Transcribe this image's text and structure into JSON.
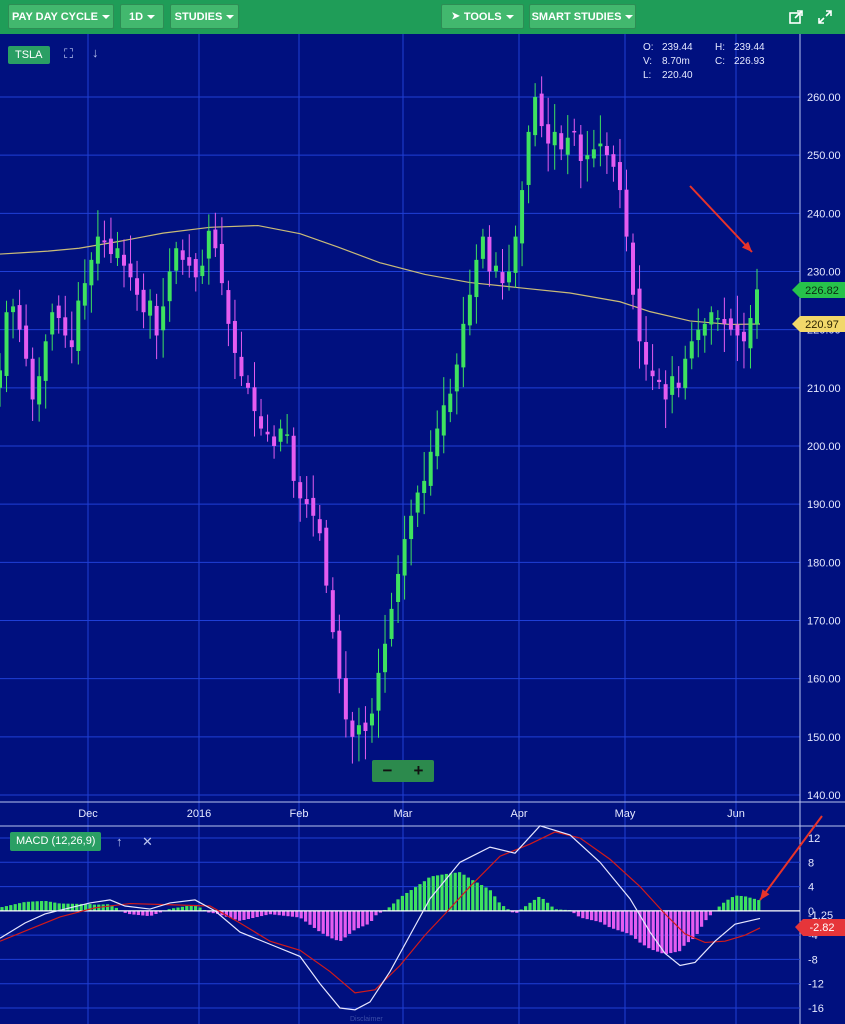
{
  "toolbar": {
    "cycle_label": "PAY DAY CYCLE",
    "interval_label": "1D",
    "studies_label": "STUDIES",
    "tools_label": "TOOLS",
    "smart_studies_label": "SMART STUDIES",
    "share_icon": "share-icon",
    "fullscreen_icon": "expand-icon"
  },
  "symbol": "TSLA",
  "ohlc": {
    "o_label": "O:",
    "o_value": "239.44",
    "h_label": "H:",
    "h_value": "239.44",
    "v_label": "V:",
    "v_value": "8.70m",
    "c_label": "C:",
    "c_value": "226.93",
    "l_label": "L:",
    "l_value": "220.40"
  },
  "price_badges": {
    "last": "226.82",
    "ma": "220.97"
  },
  "colors": {
    "background": "#00107f",
    "grid": "#1f3fd6",
    "up": "#3ee25f",
    "down": "#e45cf0",
    "ma_line": "#c9bb78",
    "macd_line": "#e6e6ff",
    "signal_line": "#d21a1a",
    "badge_last": "#27c34b",
    "badge_ma": "#f2d86a",
    "badge_macd": "#e6353a",
    "arrow": "#e8332a"
  },
  "zoom": {
    "minus": "−",
    "plus": "+"
  },
  "macd_panel": {
    "label": "MACD (12,26,9)",
    "value_a": "-1.25",
    "value_b": "-2.82"
  },
  "disclaimer": "Disclaimer",
  "chart_data": [
    {
      "type": "candlestick",
      "title": "TSLA",
      "ylim": [
        140,
        270
      ],
      "yticks": [
        "260.00",
        "250.00",
        "240.00",
        "230.00",
        "220.00",
        "210.00",
        "200.00",
        "190.00",
        "180.00",
        "170.00",
        "160.00",
        "150.00",
        "140.00"
      ],
      "xticks": [
        "Dec",
        "2016",
        "Feb",
        "Mar",
        "Apr",
        "May",
        "Jun"
      ],
      "key_points": {
        "x": [
          "Dec",
          "2016",
          "Feb",
          "Mar",
          "Apr",
          "May",
          "Jun"
        ],
        "close": [
          232,
          236,
          190,
          180,
          256,
          218,
          226.93
        ]
      },
      "closes": [
        213,
        223,
        224,
        220,
        215,
        208,
        212,
        218,
        223,
        222,
        219,
        217,
        225,
        228,
        232,
        236,
        235,
        233,
        234,
        231,
        229,
        226,
        223,
        225,
        219,
        224,
        230,
        234,
        232,
        231,
        229,
        231,
        237,
        234,
        228,
        221,
        216,
        212,
        210,
        206,
        203,
        202,
        200,
        203,
        202,
        194,
        191,
        190,
        188,
        185,
        176,
        168,
        160,
        153,
        150,
        152,
        151,
        154,
        161,
        166,
        172,
        178,
        184,
        188,
        192,
        194,
        199,
        203,
        207,
        209,
        214,
        221,
        226,
        232,
        236,
        230,
        231,
        228,
        230,
        236,
        244,
        254,
        260,
        255,
        252,
        254,
        251,
        253,
        254,
        249,
        250,
        251,
        252,
        250,
        248,
        244,
        236,
        226,
        218,
        214,
        212,
        211,
        208,
        212,
        210,
        215,
        218,
        220,
        221,
        223,
        222,
        221,
        220,
        219,
        218,
        222,
        226.93
      ],
      "ma_series": {
        "name": "",
        "points": [
          [
            0,
            233
          ],
          [
            20,
            233.2
          ],
          [
            48,
            233.5
          ],
          [
            79,
            234
          ],
          [
            120,
            235.2
          ],
          [
            163,
            236.6
          ],
          [
            210,
            237.6
          ],
          [
            258,
            237.9
          ],
          [
            300,
            236.5
          ],
          [
            338,
            234.2
          ],
          [
            380,
            231.5
          ],
          [
            425,
            229.5
          ],
          [
            470,
            228.1
          ],
          [
            520,
            227.2
          ],
          [
            570,
            226.3
          ],
          [
            620,
            224.8
          ],
          [
            650,
            223.1
          ],
          [
            690,
            221.5
          ],
          [
            730,
            220.9
          ],
          [
            760,
            220.97
          ]
        ]
      },
      "annotations": [
        "red arrow pointing to the last candle"
      ]
    },
    {
      "type": "macd",
      "title": "MACD (12,26,9)",
      "ylim": [
        -16,
        14
      ],
      "yticks": [
        "12",
        "8",
        "4",
        "0",
        "-4",
        "-8",
        "-12",
        "-16"
      ],
      "macd": [
        [
          0,
          -4.5
        ],
        [
          25,
          -2
        ],
        [
          45,
          -0.5
        ],
        [
          70,
          0.5
        ],
        [
          90,
          1.3
        ],
        [
          110,
          1.8
        ],
        [
          125,
          0.8
        ],
        [
          150,
          0.3
        ],
        [
          170,
          1.3
        ],
        [
          195,
          1.8
        ],
        [
          215,
          0
        ],
        [
          240,
          -3.5
        ],
        [
          270,
          -5.5
        ],
        [
          300,
          -7.5
        ],
        [
          320,
          -12
        ],
        [
          340,
          -16
        ],
        [
          355,
          -16.3
        ],
        [
          370,
          -15
        ],
        [
          390,
          -10
        ],
        [
          410,
          -4
        ],
        [
          430,
          2
        ],
        [
          460,
          8
        ],
        [
          490,
          10.5
        ],
        [
          515,
          9.5
        ],
        [
          540,
          14
        ],
        [
          570,
          12.5
        ],
        [
          600,
          8
        ],
        [
          630,
          2
        ],
        [
          650,
          -3.5
        ],
        [
          665,
          -7
        ],
        [
          680,
          -9
        ],
        [
          695,
          -8.5
        ],
        [
          715,
          -5
        ],
        [
          735,
          -2.2
        ],
        [
          760,
          -1.25
        ]
      ],
      "signal": [
        [
          0,
          -5
        ],
        [
          30,
          -3
        ],
        [
          60,
          -1
        ],
        [
          95,
          0.5
        ],
        [
          130,
          1.2
        ],
        [
          170,
          1
        ],
        [
          210,
          0.8
        ],
        [
          240,
          -2
        ],
        [
          270,
          -5
        ],
        [
          300,
          -6.5
        ],
        [
          330,
          -10
        ],
        [
          355,
          -13.5
        ],
        [
          375,
          -13
        ],
        [
          400,
          -9
        ],
        [
          425,
          -4
        ],
        [
          445,
          -0.5
        ],
        [
          470,
          4
        ],
        [
          500,
          9
        ],
        [
          530,
          11
        ],
        [
          555,
          13
        ],
        [
          580,
          12
        ],
        [
          610,
          8.5
        ],
        [
          640,
          4
        ],
        [
          665,
          -0.5
        ],
        [
          685,
          -3.8
        ],
        [
          705,
          -5.2
        ],
        [
          725,
          -5
        ],
        [
          745,
          -4
        ],
        [
          760,
          -2.82
        ]
      ],
      "annotations": [
        "red arrow pointing to the latest MACD histogram bar"
      ]
    }
  ]
}
